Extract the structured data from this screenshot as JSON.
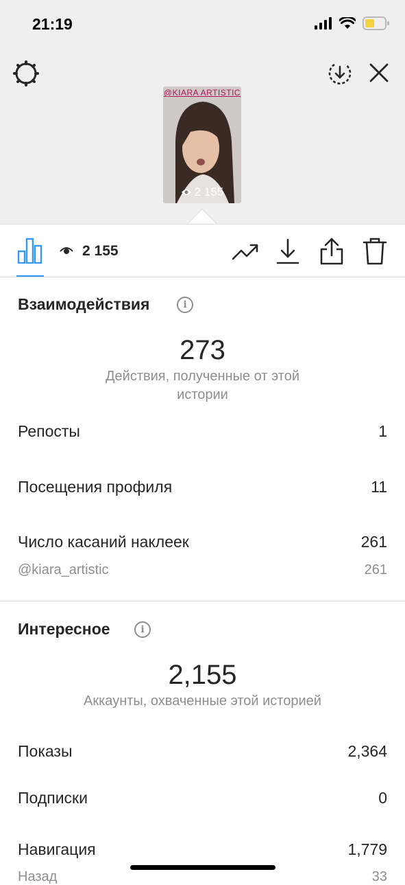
{
  "status": {
    "time": "21:19"
  },
  "story": {
    "tag": "@KIARA ARTISTIC",
    "views": "2 155"
  },
  "toolbar": {
    "views": "2 155"
  },
  "interactions": {
    "title": "Взаимодействия",
    "total": "273",
    "caption": "Действия, полученные от этой истории",
    "rows": [
      {
        "label": "Репосты",
        "value": "1"
      },
      {
        "label": "Посещения профиля",
        "value": "11"
      },
      {
        "label": "Число касаний наклеек",
        "value": "261"
      }
    ],
    "sub": {
      "label": "@kiara_artistic",
      "value": "261"
    }
  },
  "discovery": {
    "title": "Интересное",
    "total": "2,155",
    "caption": "Аккаунты, охваченные этой историей",
    "rows": [
      {
        "label": "Показы",
        "value": "2,364"
      },
      {
        "label": "Подписки",
        "value": "0"
      },
      {
        "label": "Навигация",
        "value": "1,779"
      }
    ],
    "partial": {
      "label": "Назад",
      "value": "33"
    }
  },
  "colors": {
    "accent": "#3897f0",
    "battery": "#f5d23f"
  }
}
